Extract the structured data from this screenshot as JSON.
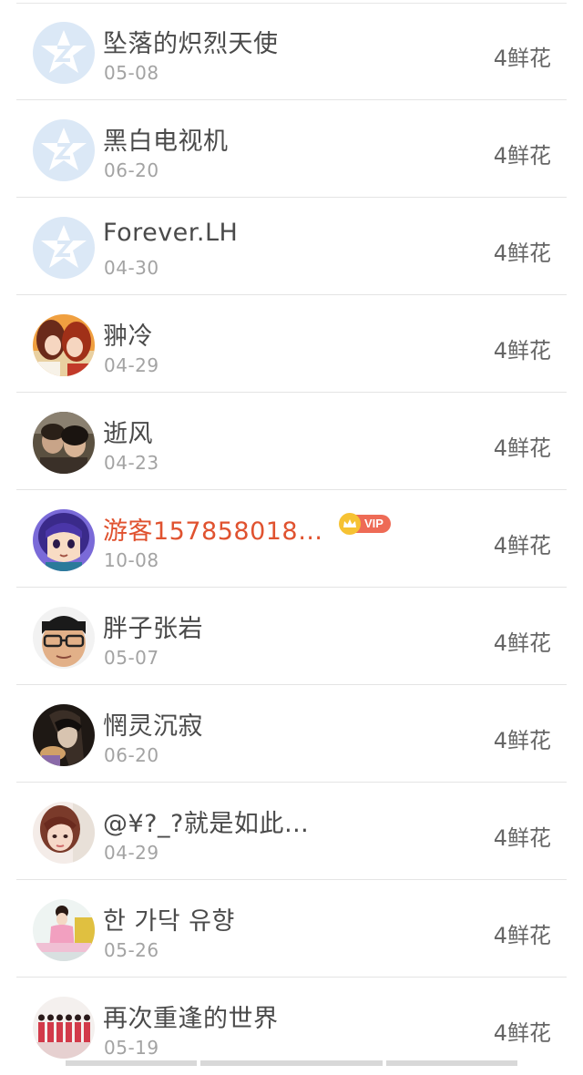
{
  "items": [
    {
      "name": "坠落的炽烈天使",
      "date": "05-08",
      "gift": "4鲜花",
      "avatar": "default-qzone-avatar"
    },
    {
      "name": "黑白电视机",
      "date": "06-20",
      "gift": "4鲜花",
      "avatar": "default-qzone-avatar"
    },
    {
      "name": "Forever.LH",
      "date": "04-30",
      "gift": "4鲜花",
      "avatar": "default-qzone-avatar"
    },
    {
      "name": "翀冷",
      "date": "04-29",
      "gift": "4鲜花",
      "avatar": "anime-girls-avatar"
    },
    {
      "name": "逝风",
      "date": "04-23",
      "gift": "4鲜花",
      "avatar": "couple-photo-avatar"
    },
    {
      "name": "游客157858018…",
      "date": "10-08",
      "gift": "4鲜花",
      "avatar": "cartoon-face-avatar",
      "vip": true
    },
    {
      "name": "胖子张岩",
      "date": "05-07",
      "gift": "4鲜花",
      "avatar": "glasses-man-avatar"
    },
    {
      "name": "惘灵沉寂",
      "date": "06-20",
      "gift": "4鲜花",
      "avatar": "dark-anime-avatar"
    },
    {
      "name": "@¥?_?就是如此…",
      "date": "04-29",
      "gift": "4鲜花",
      "avatar": "girl-photo-avatar"
    },
    {
      "name": "한 가닥 유향",
      "date": "05-26",
      "gift": "4鲜花",
      "avatar": "pink-girl-avatar"
    },
    {
      "name": "再次重逢的世界",
      "date": "05-19",
      "gift": "4鲜花",
      "avatar": "group-photo-avatar"
    }
  ],
  "vip_badge": {
    "label": "VIP",
    "icon": "crown-icon"
  },
  "colors": {
    "vip_name": "#e0522f",
    "default_avatar_bg": "#dbe8f6",
    "vip_tag": "#ee6b56",
    "crown": "#f6c233"
  }
}
